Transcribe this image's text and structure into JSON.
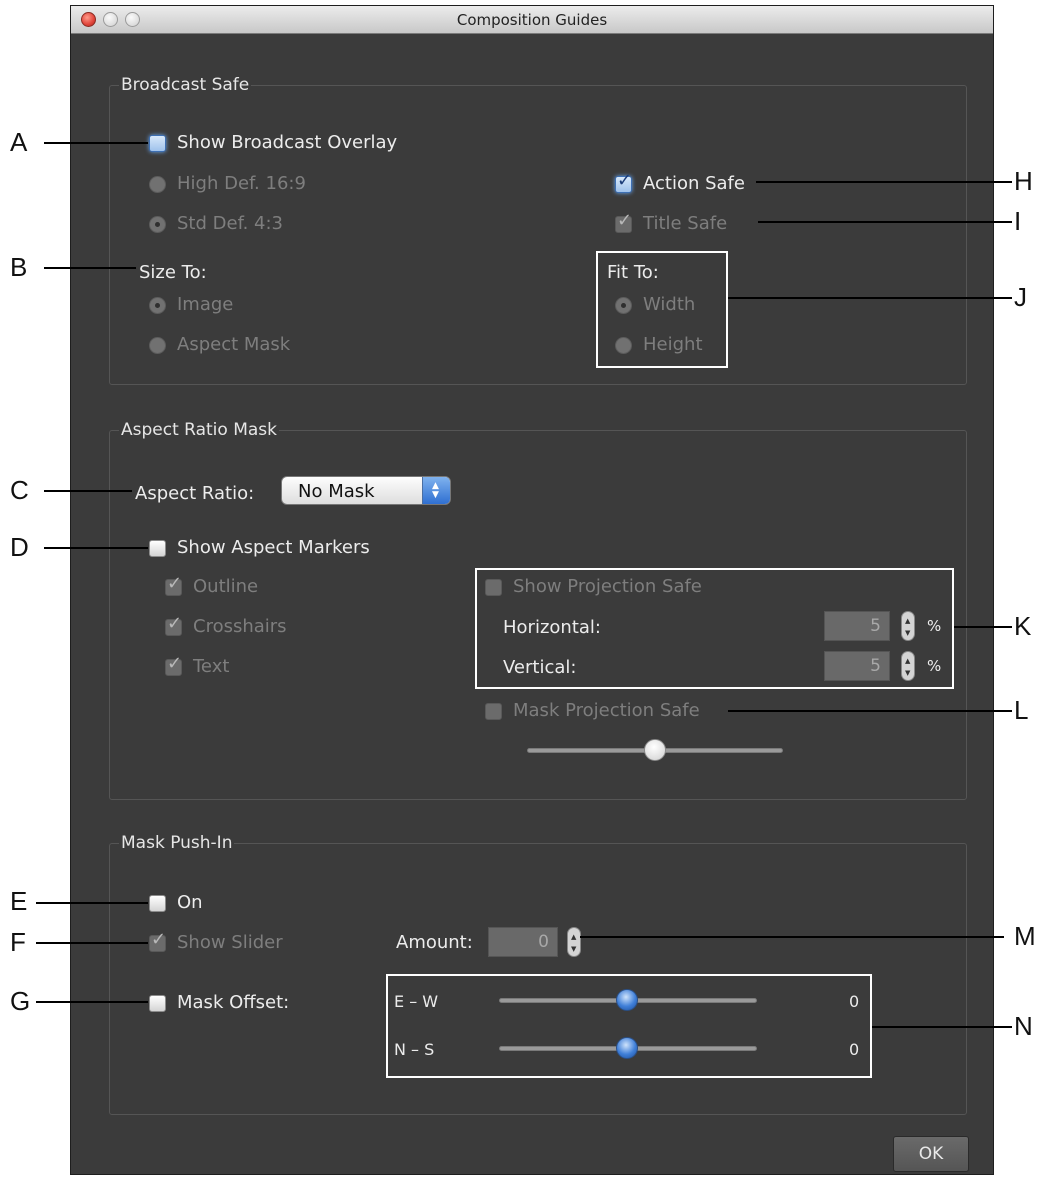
{
  "window": {
    "title": "Composition Guides"
  },
  "broadcast_safe": {
    "legend": "Broadcast Safe",
    "show_overlay": "Show Broadcast Overlay",
    "high_def": "High Def. 16:9",
    "std_def": "Std Def. 4:3",
    "action_safe": "Action Safe",
    "title_safe": "Title Safe",
    "size_to": "Size To:",
    "image": "Image",
    "aspect_mask": "Aspect Mask",
    "fit_to": "Fit To:",
    "width": "Width",
    "height": "Height"
  },
  "aspect_ratio_mask": {
    "legend": "Aspect Ratio Mask",
    "aspect_ratio_label": "Aspect Ratio:",
    "aspect_ratio_value": "No Mask",
    "show_markers": "Show Aspect Markers",
    "outline": "Outline",
    "crosshairs": "Crosshairs",
    "text": "Text",
    "show_projection_safe": "Show Projection Safe",
    "horizontal": "Horizontal:",
    "horizontal_value": "5",
    "vertical": "Vertical:",
    "vertical_value": "5",
    "percent": "%",
    "mask_projection_safe": "Mask Projection Safe",
    "opacity_slider": 0.5
  },
  "mask_push_in": {
    "legend": "Mask Push-In",
    "on": "On",
    "show_slider": "Show Slider",
    "amount_label": "Amount:",
    "amount_value": "0",
    "mask_offset": "Mask Offset:",
    "ew_label": "E – W",
    "ew_value": "0",
    "ns_label": "N – S",
    "ns_value": "0"
  },
  "ok_button": "OK",
  "callouts": [
    "A",
    "B",
    "C",
    "D",
    "E",
    "F",
    "G",
    "H",
    "I",
    "J",
    "K",
    "L",
    "M",
    "N"
  ]
}
